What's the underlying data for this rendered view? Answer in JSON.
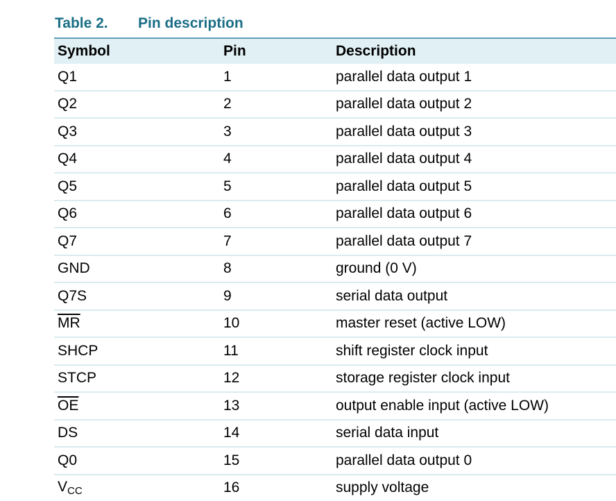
{
  "caption": {
    "number": "Table 2.",
    "title": "Pin description"
  },
  "headers": {
    "symbol": "Symbol",
    "pin": "Pin",
    "description": "Description"
  },
  "rows": [
    {
      "symbol": "Q1",
      "pin": "1",
      "description": "parallel data output 1"
    },
    {
      "symbol": "Q2",
      "pin": "2",
      "description": "parallel data output 2"
    },
    {
      "symbol": "Q3",
      "pin": "3",
      "description": "parallel data output 3"
    },
    {
      "symbol": "Q4",
      "pin": "4",
      "description": "parallel data output 4"
    },
    {
      "symbol": "Q5",
      "pin": "5",
      "description": "parallel data output 5"
    },
    {
      "symbol": "Q6",
      "pin": "6",
      "description": "parallel data output 6"
    },
    {
      "symbol": "Q7",
      "pin": "7",
      "description": "parallel data output 7"
    },
    {
      "symbol": "GND",
      "pin": "8",
      "description": "ground (0 V)"
    },
    {
      "symbol": "Q7S",
      "pin": "9",
      "description": "serial data output"
    },
    {
      "symbol": "MR",
      "overline": true,
      "pin": "10",
      "description": "master reset (active LOW)"
    },
    {
      "symbol": "SHCP",
      "pin": "11",
      "description": "shift register clock input"
    },
    {
      "symbol": "STCP",
      "pin": "12",
      "description": "storage register clock input"
    },
    {
      "symbol": "OE",
      "overline": true,
      "pin": "13",
      "description": "output enable input (active LOW)"
    },
    {
      "symbol": "DS",
      "pin": "14",
      "description": "serial data input"
    },
    {
      "symbol": "Q0",
      "pin": "15",
      "description": "parallel data output 0"
    },
    {
      "symbol": "V",
      "subscript": "CC",
      "pin": "16",
      "description": "supply voltage"
    }
  ],
  "colors": {
    "caption": "#1a6e86",
    "header_bg": "#e1f0f4",
    "header_border": "#5b9db0",
    "row_border": "#d9ebf0"
  }
}
